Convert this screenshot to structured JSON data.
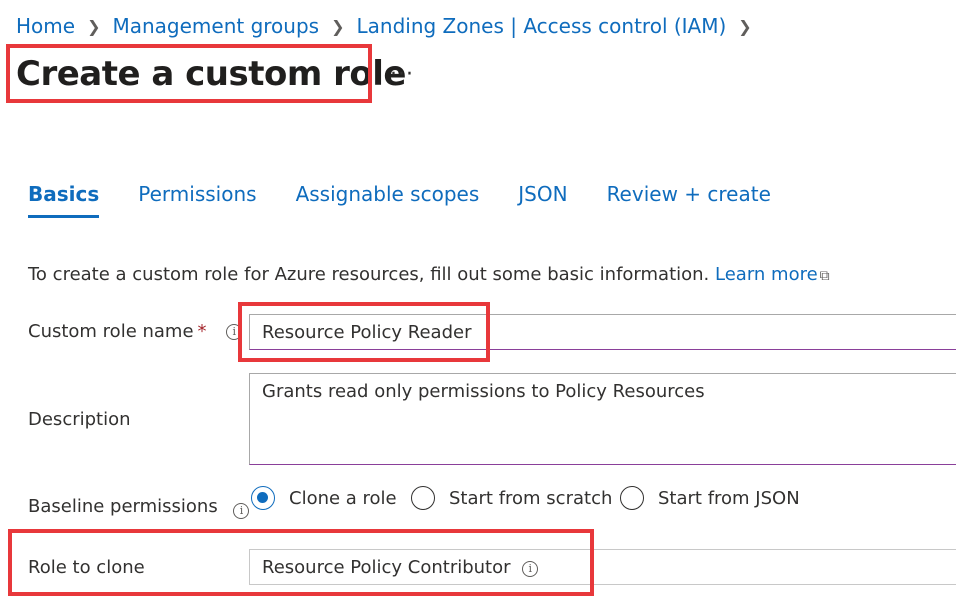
{
  "breadcrumb": {
    "items": [
      "Home",
      "Management groups",
      "Landing Zones | Access control (IAM)"
    ],
    "separator": ">"
  },
  "page": {
    "title": "Create a custom role",
    "more_label": "···"
  },
  "tabs": [
    {
      "label": "Basics",
      "active": true
    },
    {
      "label": "Permissions",
      "active": false
    },
    {
      "label": "Assignable scopes",
      "active": false
    },
    {
      "label": "JSON",
      "active": false
    },
    {
      "label": "Review + create",
      "active": false
    }
  ],
  "intro": {
    "text": "To create a custom role for Azure resources, fill out some basic information.",
    "learn_more": "Learn more"
  },
  "form": {
    "role_name": {
      "label": "Custom role name",
      "required_mark": "*",
      "value": "Resource Policy Reader"
    },
    "description": {
      "label": "Description",
      "value": "Grants read only permissions to Policy Resources"
    },
    "baseline": {
      "label": "Baseline permissions",
      "options": [
        {
          "label": "Clone a role",
          "selected": true
        },
        {
          "label": "Start from scratch",
          "selected": false
        },
        {
          "label": "Start from JSON",
          "selected": false
        }
      ]
    },
    "role_to_clone": {
      "label": "Role to clone",
      "value": "Resource Policy Contributor"
    }
  },
  "colors": {
    "accent": "#0f6cbd",
    "highlight": "#e8383b",
    "required": "#a4262c"
  },
  "icons": [
    "chevron-right-icon",
    "more-icon",
    "external-link-icon",
    "info-icon",
    "radio-icon"
  ]
}
